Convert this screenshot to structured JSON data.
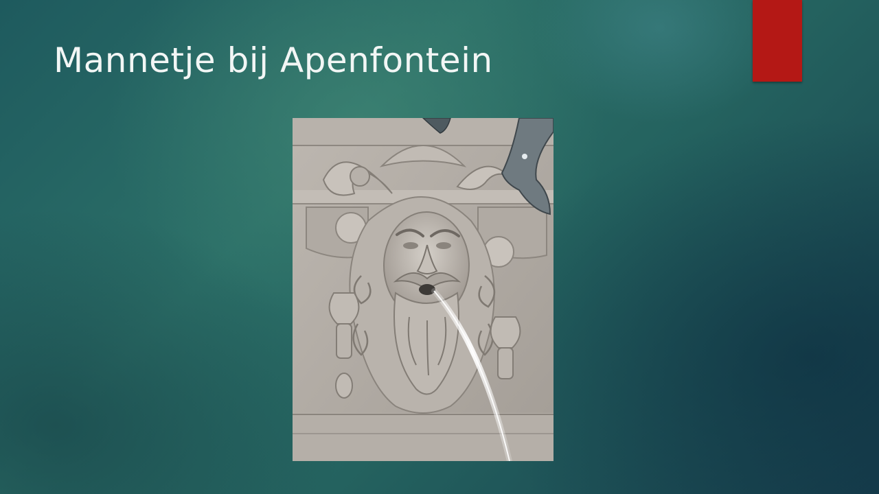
{
  "slide": {
    "title": "Mannetje bij Apenfontein"
  },
  "colors": {
    "background_dark": "#173f4d",
    "background_light": "#2c7068",
    "accent_red": "#b41815",
    "title_text": "#f2f6f5"
  }
}
